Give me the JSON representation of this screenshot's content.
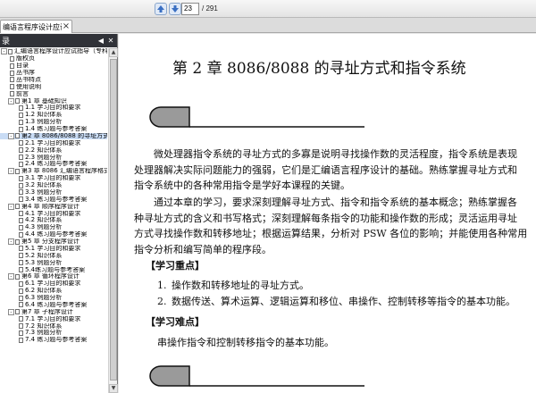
{
  "toolbar": {
    "prev_icon": "arrow-up-icon",
    "next_icon": "arrow-down-icon",
    "page_current": "23",
    "page_total": "/ 291"
  },
  "tab": {
    "title": "编语言程序设计应试指...",
    "close_icon": "close-icon"
  },
  "sidebar": {
    "title": "录",
    "items": [
      {
        "label": "汇编语言程序设计应试指导（专科）",
        "level": 0,
        "toggle": "-"
      },
      {
        "label": "版权页",
        "level": 1
      },
      {
        "label": "目录",
        "level": 1
      },
      {
        "label": "丛书序",
        "level": 1
      },
      {
        "label": "丛书特点",
        "level": 1
      },
      {
        "label": "使用说明",
        "level": 1
      },
      {
        "label": "前言",
        "level": 1
      },
      {
        "label": "第1 章  基础知识",
        "level": 1,
        "toggle": "-"
      },
      {
        "label": "1.1 学习目的和要求",
        "level": 2
      },
      {
        "label": "1.2 知识体系",
        "level": 2
      },
      {
        "label": "1.3 例题分析",
        "level": 2
      },
      {
        "label": "1.4 练习题与参考答案",
        "level": 2
      },
      {
        "label": "第2 章  8086/8088 的寻址方式和",
        "level": 1,
        "toggle": "-",
        "selected": true
      },
      {
        "label": "2.1 学习目的和要求",
        "level": 2
      },
      {
        "label": "2.2 知识体系",
        "level": 2
      },
      {
        "label": "2.3 例题分析",
        "level": 2
      },
      {
        "label": "2.4 练习题与参考答案",
        "level": 2
      },
      {
        "label": "第3 章  8086 汇编语言程序格式",
        "level": 1,
        "toggle": "-"
      },
      {
        "label": "3.1 学习目的和要求",
        "level": 2
      },
      {
        "label": "3.2 知识体系",
        "level": 2
      },
      {
        "label": "3.3 例题分析",
        "level": 2
      },
      {
        "label": "3.4 练习题与参考答案",
        "level": 2
      },
      {
        "label": "第4 章  顺序程序设计",
        "level": 1,
        "toggle": "-"
      },
      {
        "label": "4.1 学习目的和要求",
        "level": 2
      },
      {
        "label": "4.2 知识体系",
        "level": 2
      },
      {
        "label": "4.3 例题分析",
        "level": 2
      },
      {
        "label": "4.4 练习题与参考答案",
        "level": 2
      },
      {
        "label": "第5 章  分支程序设计",
        "level": 1,
        "toggle": "-"
      },
      {
        "label": "5.1 学习目的和要求",
        "level": 2
      },
      {
        "label": "5.2 知识体系",
        "level": 2
      },
      {
        "label": "5.3 例题分析",
        "level": 2
      },
      {
        "label": "5.4练习题与参考答案",
        "level": 2
      },
      {
        "label": "第6 章  循环程序设计",
        "level": 1,
        "toggle": "-"
      },
      {
        "label": "6.1 学习目的和要求",
        "level": 2
      },
      {
        "label": "6.2 知识体系",
        "level": 2
      },
      {
        "label": "6.3 例题分析",
        "level": 2
      },
      {
        "label": "6.4 练习题与参考答案",
        "level": 2
      },
      {
        "label": "第7 章  子程序设计",
        "level": 1,
        "toggle": "-"
      },
      {
        "label": "7.1 学习目的和要求",
        "level": 2
      },
      {
        "label": "7.2 知识体系",
        "level": 2
      },
      {
        "label": "7.3 例题分析",
        "level": 2
      },
      {
        "label": "7.4 练习题与参考答案",
        "level": 2
      }
    ]
  },
  "page": {
    "chapter_title": "第 2 章    8086/8088 的寻址方式和指令系统",
    "intro_para1_lines": [
      "微处理器指令系统的寻址方式的多寡是说明寻找操作数的灵活程度，指令系统是表现",
      "处理器解决实际问题能力的强弱，它们是汇编语言程序设计的基础。熟练掌握寻址方式和",
      "指令系统中的各种常用指令是学好本课程的关键。"
    ],
    "intro_para2_lines": [
      "通过本章的学习，要求深刻理解寻址方式、指令和指令系统的基本概念；熟练掌握各",
      "种寻址方式的含义和书写格式；深刻理解每条指令的功能和操作数的形成；灵活运用寻址",
      "方式寻找操作数和转移地址；根据运算结果，分析对 PSW 各位的影响；并能使用各种常用",
      "指令分析和编写简单的程序段。"
    ],
    "key_heading": "【学习重点】",
    "key_points": [
      {
        "num": "1.",
        "text": "操作数和转移地址的寻址方式。"
      },
      {
        "num": "2.",
        "text": "数据传送、算术运算、逻辑运算和移位、串操作、控制转移等指令的基本功能。"
      }
    ],
    "difficult_heading": "【学习难点】",
    "difficult_text": "串操作指令和控制转移指令的基本功能。"
  },
  "colors": {
    "sidebar_header": "#303238",
    "selected_row": "#c9dcf5",
    "nav_button": "#dfe9f7",
    "deco_fill": "#9a9a9a"
  }
}
